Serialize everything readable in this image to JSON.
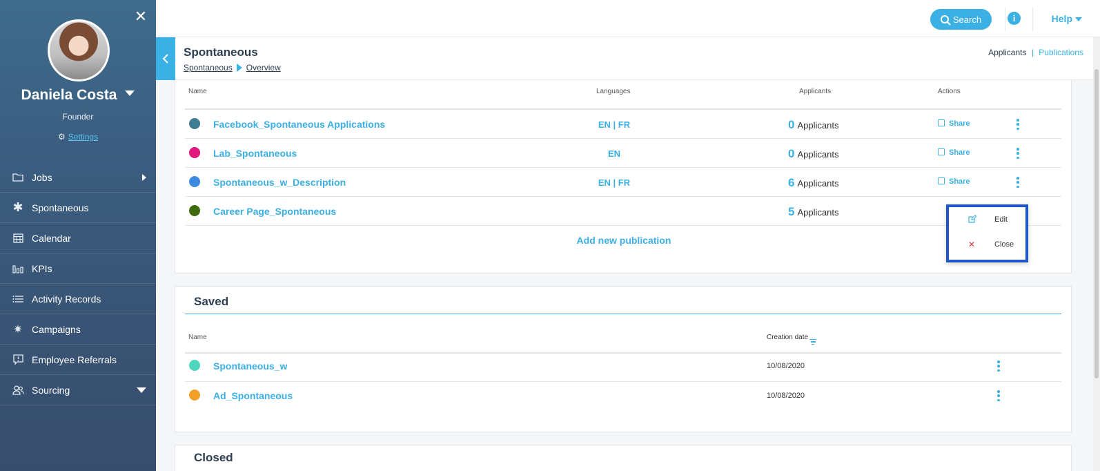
{
  "sidebar": {
    "user": {
      "name": "Daniela Costa",
      "role": "Founder"
    },
    "settings_label": "Settings",
    "items": [
      {
        "label": "Jobs",
        "icon": "folder-icon"
      },
      {
        "label": "Spontaneous",
        "icon": "asterisk-icon"
      },
      {
        "label": "Calendar",
        "icon": "calendar-icon"
      },
      {
        "label": "KPIs",
        "icon": "bar-chart-icon"
      },
      {
        "label": "Activity Records",
        "icon": "list-icon"
      },
      {
        "label": "Campaigns",
        "icon": "sparkle-icon"
      },
      {
        "label": "Employee Referrals",
        "icon": "comment-alert-icon"
      },
      {
        "label": "Sourcing",
        "icon": "users-icon"
      }
    ]
  },
  "topbar": {
    "search_label": "Search",
    "help_label": "Help"
  },
  "header": {
    "title": "Spontaneous",
    "breadcrumb": [
      "Spontaneous",
      "Overview"
    ],
    "toggle": {
      "applicants": "Applicants",
      "separator": "|",
      "publications": "Publications"
    }
  },
  "published": {
    "columns": {
      "name": "Name",
      "languages": "Languages",
      "applicants": "Applicants",
      "actions": "Actions"
    },
    "rows": [
      {
        "name": "Facebook_Spontaneous Applications",
        "languages": "EN | FR",
        "count": "0",
        "count_label": "Applicants",
        "share": "Share",
        "color": "#3f7d92"
      },
      {
        "name": "Lab_Spontaneous",
        "languages": "EN",
        "count": "0",
        "count_label": "Applicants",
        "share": "Share",
        "color": "#e0197d"
      },
      {
        "name": "Spontaneous_w_Description",
        "languages": "EN | FR",
        "count": "6",
        "count_label": "Applicants",
        "share": "Share",
        "color": "#3d8be0"
      },
      {
        "name": "Career Page_Spontaneous",
        "languages": "",
        "count": "5",
        "count_label": "Applicants",
        "share": "",
        "color": "#3f6b0d"
      }
    ],
    "add_label": "Add new publication"
  },
  "dropdown": {
    "edit": "Edit",
    "close": "Close"
  },
  "saved": {
    "title": "Saved",
    "columns": {
      "name": "Name",
      "creation_date": "Creation date"
    },
    "rows": [
      {
        "name": "Spontaneous_w",
        "date": "10/08/2020",
        "color": "#4fd6bf"
      },
      {
        "name": "Ad_Spontaneous",
        "date": "10/08/2020",
        "color": "#f2a12a"
      }
    ]
  },
  "closed": {
    "title": "Closed"
  }
}
